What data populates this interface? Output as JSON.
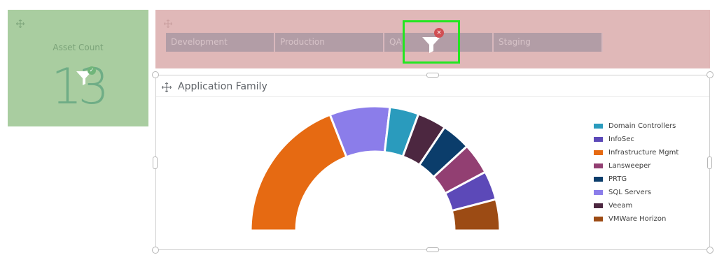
{
  "asset_count": {
    "title": "Asset Count",
    "value": "13",
    "filter_icon": "filter-icon",
    "badge_icon": "check-icon"
  },
  "environment": {
    "buttons": [
      {
        "label": "Development"
      },
      {
        "label": "Production"
      },
      {
        "label": "QA"
      },
      {
        "label": "Staging"
      }
    ],
    "filter_icon": "filter-icon",
    "remove_icon": "close-icon"
  },
  "chart_tile": {
    "title": "Application Family"
  },
  "chart_data": {
    "type": "pie",
    "title": "Application Family",
    "style": "half-donut",
    "slices": [
      {
        "label": "Infrastructure Mgmt",
        "value": 33.0,
        "color": "#e66a12"
      },
      {
        "label": "SQL Servers",
        "value": 13.5,
        "color": "#8b7dea"
      },
      {
        "label": "Domain Controllers",
        "value": 6.5,
        "color": "#2a9bbd"
      },
      {
        "label": "Veeam",
        "value": 6.5,
        "color": "#4c2740"
      },
      {
        "label": "PRTG",
        "value": 6.5,
        "color": "#0b3d6b"
      },
      {
        "label": "Lansweeper",
        "value": 7.0,
        "color": "#923f72"
      },
      {
        "label": "InfoSec",
        "value": 6.5,
        "color": "#5c49b8"
      },
      {
        "label": "VMWare Horizon",
        "value": 7.0,
        "color": "#9c4b14"
      }
    ],
    "legend": [
      {
        "label": "Domain Controllers",
        "color": "#2a9bbd"
      },
      {
        "label": "InfoSec",
        "color": "#5c49b8"
      },
      {
        "label": "Infrastructure Mgmt",
        "color": "#e66a12"
      },
      {
        "label": "Lansweeper",
        "color": "#923f72"
      },
      {
        "label": "PRTG",
        "color": "#0b3d6b"
      },
      {
        "label": "SQL Servers",
        "color": "#8b7dea"
      },
      {
        "label": "Veeam",
        "color": "#4c2740"
      },
      {
        "label": "VMWare Horizon",
        "color": "#9c4b14"
      }
    ],
    "legend_position": "right"
  }
}
